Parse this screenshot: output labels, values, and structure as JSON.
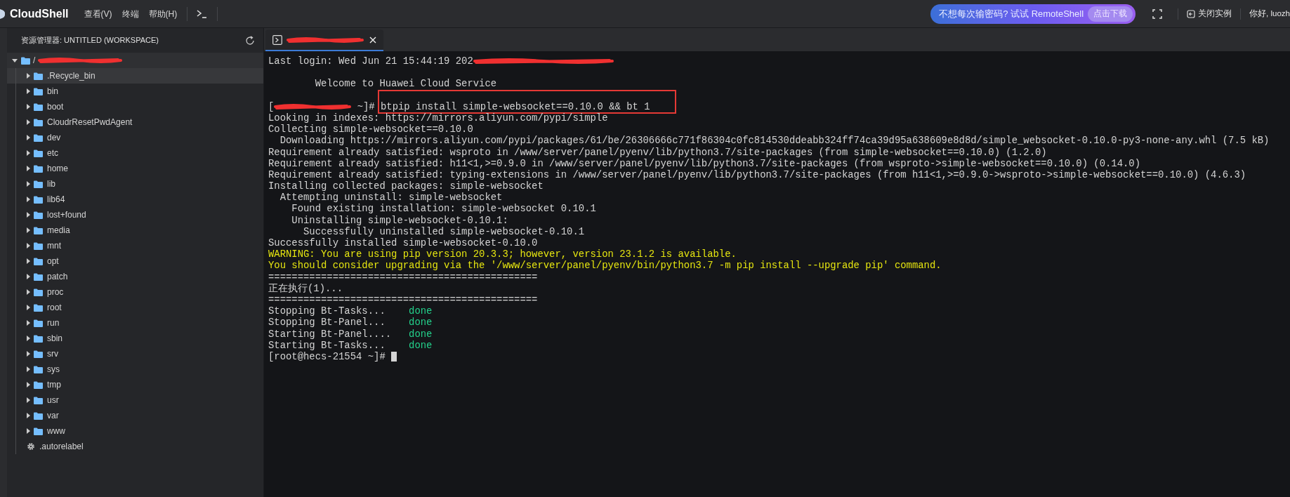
{
  "topbar": {
    "brand": "CloudShell",
    "menus": [
      "查看(V)",
      "终端",
      "帮助(H)"
    ],
    "promo": {
      "text": "不想每次输密码? 试试 RemoteShell",
      "button": "点击下载"
    },
    "close_instance": "关闭实例",
    "greeting": "你好, luozh"
  },
  "sidebar": {
    "title": "资源管理器: UNTITLED (WORKSPACE)",
    "root": {
      "name": "/",
      "expanded": true,
      "children": [
        {
          "name": ".Recycle_bin",
          "kind": "folder",
          "selected": true
        },
        {
          "name": "bin",
          "kind": "folder",
          "selected": false
        },
        {
          "name": "boot",
          "kind": "folder",
          "selected": false
        },
        {
          "name": "CloudrResetPwdAgent",
          "kind": "folder",
          "selected": false
        },
        {
          "name": "dev",
          "kind": "folder",
          "selected": false
        },
        {
          "name": "etc",
          "kind": "folder",
          "selected": false
        },
        {
          "name": "home",
          "kind": "folder",
          "selected": false
        },
        {
          "name": "lib",
          "kind": "folder",
          "selected": false
        },
        {
          "name": "lib64",
          "kind": "folder",
          "selected": false
        },
        {
          "name": "lost+found",
          "kind": "folder",
          "selected": false
        },
        {
          "name": "media",
          "kind": "folder",
          "selected": false
        },
        {
          "name": "mnt",
          "kind": "folder",
          "selected": false
        },
        {
          "name": "opt",
          "kind": "folder",
          "selected": false
        },
        {
          "name": "patch",
          "kind": "folder",
          "selected": false
        },
        {
          "name": "proc",
          "kind": "folder",
          "selected": false
        },
        {
          "name": "root",
          "kind": "folder",
          "selected": false
        },
        {
          "name": "run",
          "kind": "folder",
          "selected": false
        },
        {
          "name": "sbin",
          "kind": "folder",
          "selected": false
        },
        {
          "name": "srv",
          "kind": "folder",
          "selected": false
        },
        {
          "name": "sys",
          "kind": "folder",
          "selected": false
        },
        {
          "name": "tmp",
          "kind": "folder",
          "selected": false
        },
        {
          "name": "usr",
          "kind": "folder",
          "selected": false
        },
        {
          "name": "var",
          "kind": "folder",
          "selected": false
        },
        {
          "name": "www",
          "kind": "folder",
          "selected": false
        },
        {
          "name": ".autorelabel",
          "kind": "file",
          "selected": false
        }
      ]
    }
  },
  "terminal": {
    "lines": [
      {
        "kind": "redacted",
        "text": "Last login: Wed Jun 21 15:44:19 202"
      },
      {
        "kind": "blank"
      },
      {
        "kind": "text",
        "text": "        Welcome to Huawei Cloud Service"
      },
      {
        "kind": "blank"
      },
      {
        "kind": "command",
        "prefix": "[",
        "prompt": " ~]# ",
        "text": "btpip install simple-websocket==0.10.0 && bt 1"
      },
      {
        "kind": "text",
        "text": "Looking in indexes: https://mirrors.aliyun.com/pypi/simple"
      },
      {
        "kind": "text",
        "text": "Collecting simple-websocket==0.10.0"
      },
      {
        "kind": "text",
        "text": "  Downloading https://mirrors.aliyun.com/pypi/packages/61/be/26306666c771f86304c0fc814530ddeabb324ff74ca39d95a638609e8d8d/simple_websocket-0.10.0-py3-none-any.whl (7.5 kB)"
      },
      {
        "kind": "text",
        "text": "Requirement already satisfied: wsproto in /www/server/panel/pyenv/lib/python3.7/site-packages (from simple-websocket==0.10.0) (1.2.0)"
      },
      {
        "kind": "text",
        "text": "Requirement already satisfied: h11<1,>=0.9.0 in /www/server/panel/pyenv/lib/python3.7/site-packages (from wsproto->simple-websocket==0.10.0) (0.14.0)"
      },
      {
        "kind": "text",
        "text": "Requirement already satisfied: typing-extensions in /www/server/panel/pyenv/lib/python3.7/site-packages (from h11<1,>=0.9.0->wsproto->simple-websocket==0.10.0) (4.6.3)"
      },
      {
        "kind": "text",
        "text": "Installing collected packages: simple-websocket"
      },
      {
        "kind": "text",
        "text": "  Attempting uninstall: simple-websocket"
      },
      {
        "kind": "text",
        "text": "    Found existing installation: simple-websocket 0.10.1"
      },
      {
        "kind": "text",
        "text": "    Uninstalling simple-websocket-0.10.1:"
      },
      {
        "kind": "text",
        "text": "      Successfully uninstalled simple-websocket-0.10.1"
      },
      {
        "kind": "text",
        "text": "Successfully installed simple-websocket-0.10.0"
      },
      {
        "kind": "warning",
        "text": "WARNING: You are using pip version 20.3.3; however, version 23.1.2 is available."
      },
      {
        "kind": "warning",
        "text": "You should consider upgrading via the '/www/server/panel/pyenv/bin/python3.7 -m pip install --upgrade pip' command."
      },
      {
        "kind": "text",
        "text": "=============================================="
      },
      {
        "kind": "text",
        "text": "正在执行(1)..."
      },
      {
        "kind": "text",
        "text": "=============================================="
      },
      {
        "kind": "status",
        "text": "Stopping Bt-Tasks...    ",
        "status": "done"
      },
      {
        "kind": "status",
        "text": "Stopping Bt-Panel...    ",
        "status": "done"
      },
      {
        "kind": "status",
        "text": "Starting Bt-Panel....   ",
        "status": "done"
      },
      {
        "kind": "status",
        "text": "Starting Bt-Tasks...    ",
        "status": "done"
      },
      {
        "kind": "prompt",
        "text": "[root@hecs-21554 ~]# "
      }
    ]
  }
}
